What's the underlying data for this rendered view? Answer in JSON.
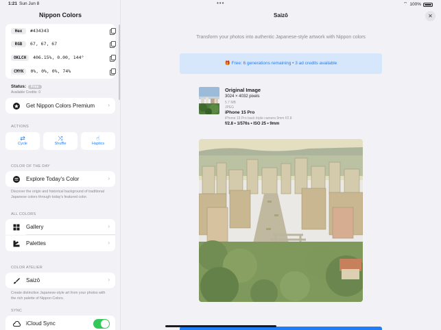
{
  "status_bar": {
    "time": "1:21",
    "date": "Sun Jun 8",
    "battery": "100%"
  },
  "sidebar": {
    "title": "Nippon Colors",
    "color_codes": [
      {
        "label": "Hex",
        "value": "#434343"
      },
      {
        "label": "RGB",
        "value": "67, 67, 67"
      },
      {
        "label": "OKLCH",
        "value": "406.15%, 0.00, 144°"
      },
      {
        "label": "CMYK",
        "value": "0%, 0%, 0%, 74%"
      }
    ],
    "status_label": "Status:",
    "status_badge": "Free",
    "credits_text": "Available Credits: 0",
    "premium_label": "Get Nippon Colors Premium",
    "actions_header": "ACTIONS",
    "actions": [
      {
        "label": "Cycle",
        "icon": "arrows-cycle-icon"
      },
      {
        "label": "Shuffle",
        "icon": "shuffle-icon"
      },
      {
        "label": "Haptics",
        "icon": "hand-tap-icon"
      }
    ],
    "cotd_header": "COLOR OF THE DAY",
    "explore_label": "Explore Today's Color",
    "explore_desc": "Discover the origin and historical background of traditional Japanese colors through today's featured color.",
    "all_colors_header": "ALL COLORS",
    "gallery_label": "Gallery",
    "palettes_label": "Palettes",
    "atelier_header": "COLOR ATELIER",
    "saizo_label": "Saizō",
    "saizo_desc": "Create distinctive Japanese-style art from your photos with the rich palette of Nippon Colors.",
    "sync_header": "SYNC",
    "icloud_label": "iCloud Sync",
    "icloud_on": true
  },
  "main": {
    "title": "Saizō",
    "tagline": "Transform your photos into authentic Japanese-style artwork with Nippon colors",
    "banner": "🎁 Free: 6 generations remaining • 3 ad credits available",
    "original": {
      "title": "Original Image",
      "dimensions": "3024 × 4032 pixels",
      "size": "5.7 MB",
      "format": "JPEG",
      "device": "iPhone 15 Pro",
      "lens": "iPhone 15 Pro back triple camera 9mm f/2.8",
      "exif": "f/2.8 • 1/576s • ISO 25 • 9mm"
    }
  },
  "colors": {
    "accent": "#1f7ef7",
    "toggle_on": "#34c759",
    "banner_bg": "#d6e6fb"
  }
}
